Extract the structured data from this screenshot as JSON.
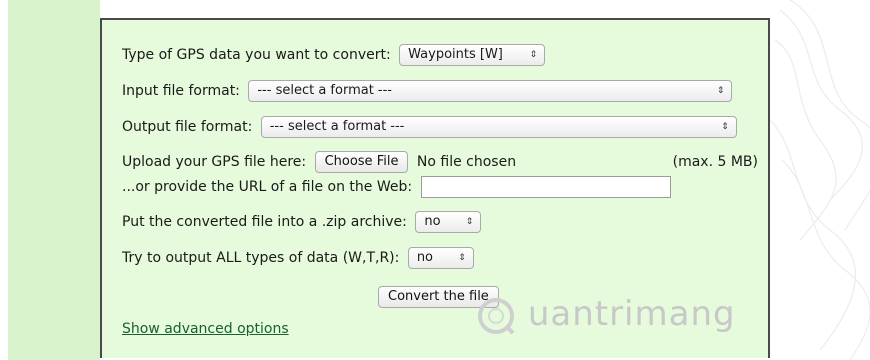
{
  "form": {
    "gps_type": {
      "label": "Type of GPS data you want to convert:",
      "value": "Waypoints [W]"
    },
    "input_format": {
      "label": "Input file format:",
      "value": "--- select a format ---"
    },
    "output_format": {
      "label": "Output file format:",
      "value": "--- select a format ---"
    },
    "upload": {
      "label": "Upload your GPS file here:",
      "button": "Choose File",
      "status": "No file chosen",
      "limit": "(max. 5 MB)"
    },
    "url": {
      "label": "...or provide the URL of a file on the Web:",
      "value": ""
    },
    "zip": {
      "label": "Put the converted file into a .zip archive:",
      "value": "no"
    },
    "all_types": {
      "label": "Try to output ALL types of data (W,T,R):",
      "value": "no"
    },
    "convert_button": "Convert the file",
    "advanced_link": "Show advanced options"
  },
  "watermark": {
    "text": "uantrimang"
  },
  "colors": {
    "panel_bg": "#e6fadc",
    "strip_bg": "#d8f2cc",
    "border": "#4a4a4a",
    "link": "#17622e"
  },
  "icons": {
    "select_arrows": "updown-arrows-icon"
  }
}
